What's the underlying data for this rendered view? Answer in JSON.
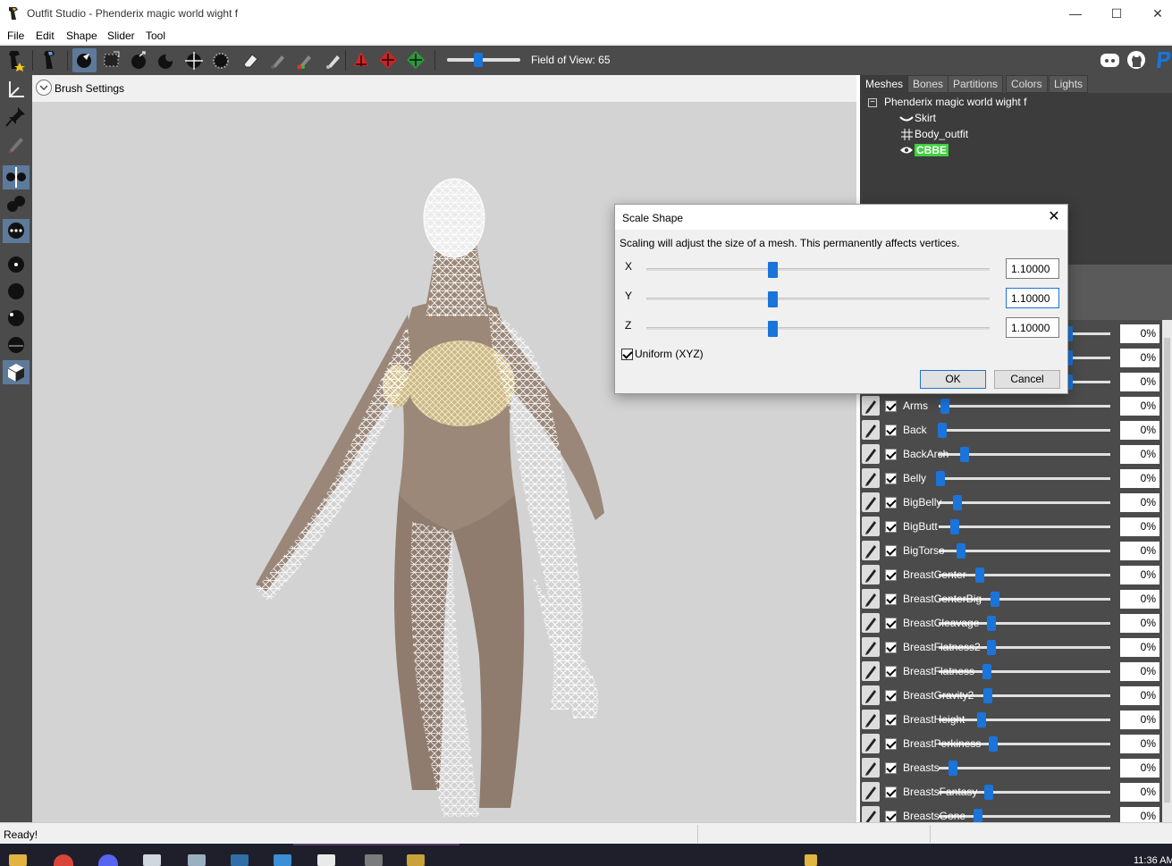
{
  "window": {
    "title": "Outfit Studio - Phenderix magic world wight f",
    "minimize": "—",
    "maximize": "☐",
    "close": "✕"
  },
  "menu": [
    "File",
    "Edit",
    "Shape",
    "Slider",
    "Tool"
  ],
  "toolbar": {
    "field_of_view_label": "Field of View: 65",
    "field_of_view": 65
  },
  "brush_settings_label": "Brush Settings",
  "tabs": [
    "Meshes",
    "Bones",
    "Partitions",
    "Colors",
    "Lights"
  ],
  "mesh_tree": {
    "root": "Phenderix magic world wight f",
    "expander": "−",
    "children": [
      "Skirt",
      "Body_outfit",
      "CBBE"
    ]
  },
  "sliders": [
    {
      "name": "",
      "value": "0%"
    },
    {
      "name": "",
      "value": "0%"
    },
    {
      "name": "",
      "value": "0%"
    },
    {
      "name": "Arms",
      "value": "0%"
    },
    {
      "name": "Back",
      "value": "0%"
    },
    {
      "name": "BackArch",
      "value": "0%"
    },
    {
      "name": "Belly",
      "value": "0%"
    },
    {
      "name": "BigBelly",
      "value": "0%"
    },
    {
      "name": "BigButt",
      "value": "0%"
    },
    {
      "name": "BigTorso",
      "value": "0%"
    },
    {
      "name": "BreastCenter",
      "value": "0%"
    },
    {
      "name": "BreastCenterBig",
      "value": "0%"
    },
    {
      "name": "BreastCleavage",
      "value": "0%"
    },
    {
      "name": "BreastFlatness2",
      "value": "0%"
    },
    {
      "name": "BreastFlatness",
      "value": "0%"
    },
    {
      "name": "BreastGravity2",
      "value": "0%"
    },
    {
      "name": "BreastHeight",
      "value": "0%"
    },
    {
      "name": "BreastPerkiness",
      "value": "0%"
    },
    {
      "name": "Breasts",
      "value": "0%"
    },
    {
      "name": "BreastsFantasy",
      "value": "0%"
    },
    {
      "name": "BreastsGone",
      "value": "0%"
    }
  ],
  "status": "Ready!",
  "clock": "11:36 AM",
  "dialog": {
    "title": "Scale Shape",
    "close": "✕",
    "description": "Scaling will adjust the size of a mesh. This permanently affects vertices.",
    "axes": [
      {
        "label": "X",
        "value": "1.10000"
      },
      {
        "label": "Y",
        "value": "1.10000"
      },
      {
        "label": "Z",
        "value": "1.10000"
      }
    ],
    "uniform_label": "Uniform (XYZ)",
    "uniform_checked": true,
    "ok": "OK",
    "cancel": "Cancel"
  },
  "colors": {
    "accent": "#1a74d9",
    "panel": "#4b4b4b",
    "viewport": "#d3d3d3",
    "selected_shape": "#3fd13f"
  }
}
